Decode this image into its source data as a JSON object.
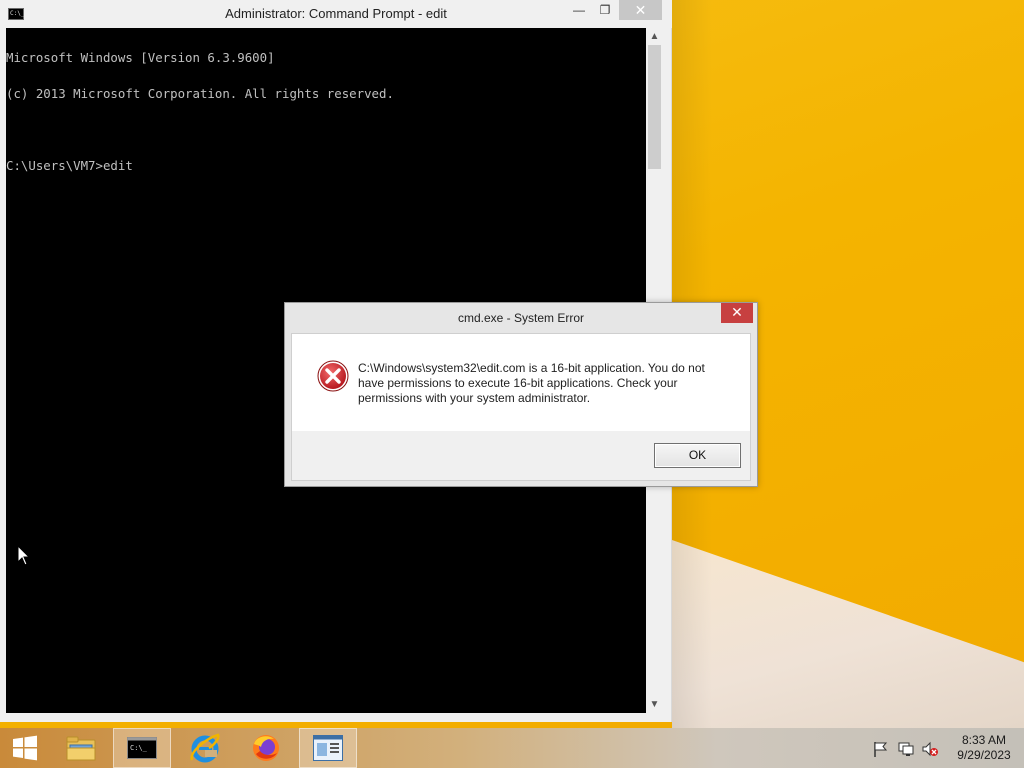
{
  "cmd_window": {
    "title": "Administrator: Command Prompt - edit",
    "icon_text": "C:\\_",
    "minimize_glyph": "—",
    "maximize_glyph": "❐",
    "close_glyph": "✕",
    "console_lines": [
      "Microsoft Windows [Version 6.3.9600]",
      "(c) 2013 Microsoft Corporation. All rights reserved.",
      "",
      "C:\\Users\\VM7>edit"
    ],
    "scroll_up_glyph": "▲",
    "scroll_down_glyph": "▼"
  },
  "dialog": {
    "title": "cmd.exe - System Error",
    "close_glyph": "✕",
    "message": "C:\\Windows\\system32\\edit.com is a 16-bit application. You do not have permissions to execute 16-bit applications. Check your permissions with your system administrator.",
    "ok_label": "OK",
    "icon": "error-icon"
  },
  "taskbar": {
    "items": [
      {
        "name": "start",
        "icon": "windows-logo-icon"
      },
      {
        "name": "file-explorer",
        "icon": "folder-icon"
      },
      {
        "name": "command-prompt",
        "icon": "cmd-icon",
        "active": true
      },
      {
        "name": "internet-explorer",
        "icon": "ie-icon"
      },
      {
        "name": "firefox",
        "icon": "firefox-icon"
      },
      {
        "name": "app",
        "icon": "document-app-icon",
        "active": true
      }
    ],
    "tray_icons": [
      "flag-icon",
      "network-icon",
      "volume-muted-icon"
    ],
    "clock_time": "8:33 AM",
    "clock_date": "9/29/2023"
  },
  "colors": {
    "console_bg": "#000000",
    "console_fg": "#c0c0c0",
    "dialog_close": "#c74040",
    "error_red": "#c81e1e",
    "wallpaper": "#f4b400"
  }
}
